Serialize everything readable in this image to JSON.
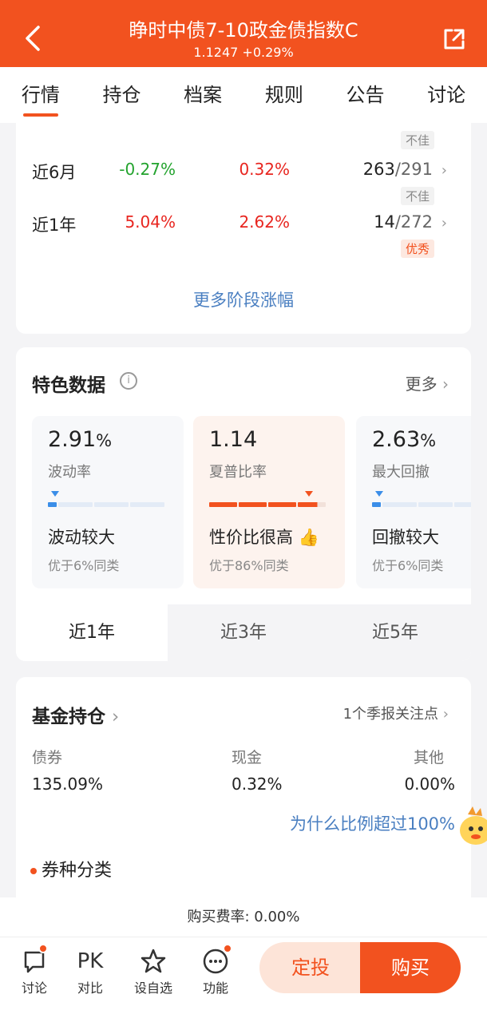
{
  "header": {
    "title": "睁时中债7-10政金债指数C",
    "nav": "1.1247 +0.29%"
  },
  "tabs": [
    "行情",
    "持仓",
    "档案",
    "规则",
    "公告",
    "讨论"
  ],
  "performance": {
    "rows": [
      {
        "period": "近6月",
        "fund_return": "-0.27%",
        "avg_return": "0.32%",
        "rank": "263",
        "total": "/291",
        "badge": "不佳"
      },
      {
        "period": "近1年",
        "fund_return": "5.04%",
        "avg_return": "2.62%",
        "rank": "14",
        "total": "/272",
        "badge": "优秀"
      }
    ],
    "partial_badge": "不佳",
    "more_link": "更多阶段涨幅"
  },
  "features": {
    "title": "特色数据",
    "more": "更多",
    "metrics": [
      {
        "value": "2.91",
        "unit": "%",
        "label": "波动率",
        "verdict": "波动较大",
        "compare": "优于6%同类",
        "level": 0.06
      },
      {
        "value": "1.14",
        "unit": "",
        "label": "夏普比率",
        "verdict": "性价比很高",
        "compare": "优于86%同类",
        "level": 0.86
      },
      {
        "value": "2.63",
        "unit": "%",
        "label": "最大回撤",
        "verdict": "回撤较大",
        "compare": "优于6%同类",
        "level": 0.06
      }
    ],
    "periods": [
      "近1年",
      "近3年",
      "近5年"
    ]
  },
  "holdings": {
    "title": "基金持仓",
    "notice": "1个季报关注点",
    "columns": [
      {
        "label": "债券",
        "value": "135.09%"
      },
      {
        "label": "现金",
        "value": "0.32%"
      },
      {
        "label": "其他",
        "value": "0.00%"
      }
    ],
    "why_link": "为什么比例超过100%",
    "sub_section": "券种分类"
  },
  "fee": "购买费率: 0.00%",
  "bottom": {
    "items": [
      {
        "label": "讨论",
        "icon": "chat-icon"
      },
      {
        "label": "对比",
        "icon": "pk-icon",
        "text": "PK"
      },
      {
        "label": "设自选",
        "icon": "star-icon"
      },
      {
        "label": "功能",
        "icon": "more-icon"
      }
    ],
    "dingtou": "定投",
    "buy": "购买"
  },
  "colors": {
    "brand": "#f2521f",
    "up": "#e8251f",
    "down": "#23a32e",
    "link": "#4a7fc1"
  }
}
